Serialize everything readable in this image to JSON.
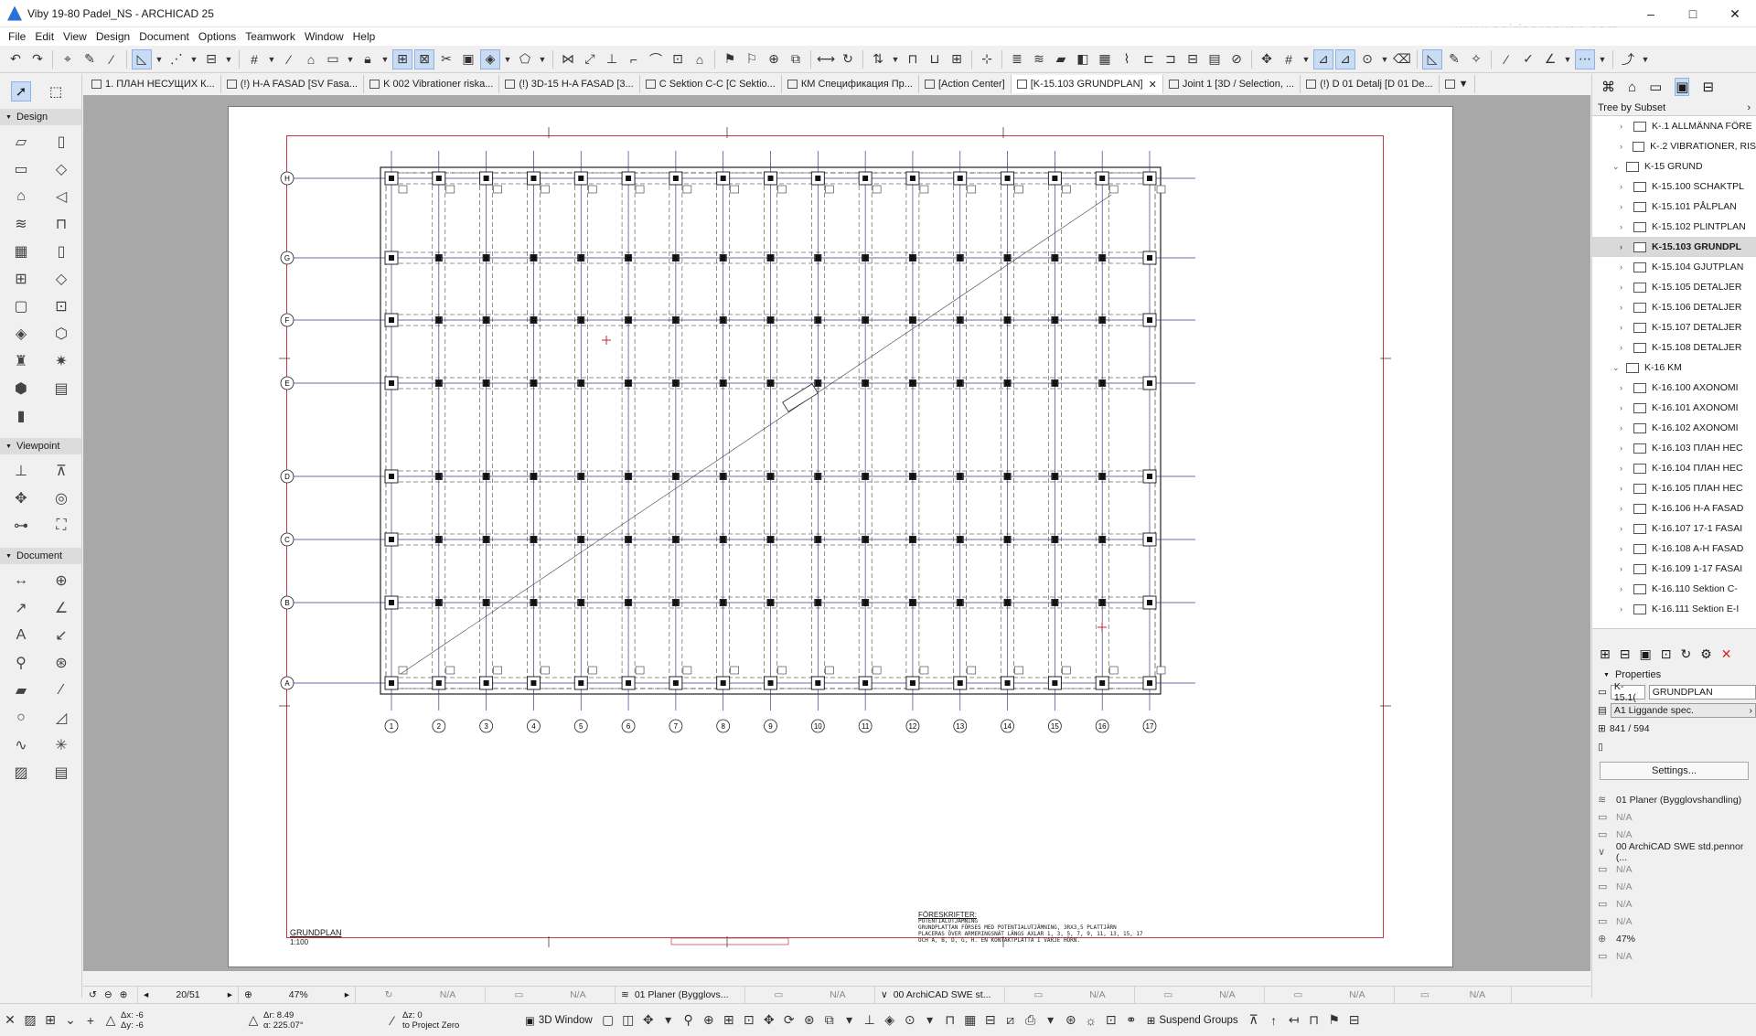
{
  "window": {
    "title": "Viby 19-80 Padel_NS - ARCHICAD 25",
    "watermark": "www.nairisargsyan.com",
    "controls": [
      "–",
      "□",
      "✕"
    ]
  },
  "menu": [
    "File",
    "Edit",
    "View",
    "Design",
    "Document",
    "Options",
    "Teamwork",
    "Window",
    "Help"
  ],
  "tabs": [
    {
      "label": "1. ПЛАН НЕСУЩИХ К...",
      "active": false
    },
    {
      "label": "(!) H-A FASAD  [SV Fasa...",
      "active": false
    },
    {
      "label": "K 002 Vibrationer riska...",
      "active": false
    },
    {
      "label": "(!) 3D-15 H-A FASAD [3...",
      "active": false
    },
    {
      "label": "C Sektion C-C [C Sektio...",
      "active": false
    },
    {
      "label": "КМ Спецификация Пр...",
      "active": false
    },
    {
      "label": "[Action Center]",
      "active": false
    },
    {
      "label": "[K-15.103 GRUNDPLAN]",
      "active": true
    },
    {
      "label": "Joint 1 [3D / Selection, ...",
      "active": false
    },
    {
      "label": "(!) D 01 Detalj [D 01 De...",
      "active": false
    }
  ],
  "toolbox": {
    "design_label": "Design",
    "viewpoint_label": "Viewpoint",
    "document_label": "Document"
  },
  "drawing": {
    "grid_rows": [
      "H",
      "G",
      "F",
      "E",
      "D",
      "C",
      "B",
      "A"
    ],
    "grid_cols": [
      "1",
      "2",
      "3",
      "4",
      "5",
      "6",
      "7",
      "8",
      "9",
      "10",
      "11",
      "12",
      "13",
      "14",
      "15",
      "16",
      "17"
    ],
    "title": "GRUNDPLAN",
    "scale": "1:100",
    "notes_heading": "FÖRESKRIFTER:",
    "notes_lines": [
      "POTENTIALUTJÄMNING",
      "GRUNDPLATTAN FÖRSES MED POTENTIALUTJÄMNING, 3RX3,5 PLATTJÄRN",
      "PLACERAS ÖVER ARMERINGSNÄT LÄNGS AXLAR 1, 3, 5, 7, 9, 11, 13, 15, 17",
      "OCH A, B, D, G, H. EN KONTAKTPLATTA I VARJE HÖRN."
    ]
  },
  "navigator": {
    "subset_label": "Tree by Subset",
    "tree": [
      {
        "label": "K-.1 ALLMÄNNA FÖRE",
        "level": 1,
        "chevron": "›",
        "selected": false
      },
      {
        "label": "K-.2 VIBRATIONER, RIS",
        "level": 1,
        "chevron": "›",
        "selected": false
      },
      {
        "label": "K-15 GRUND",
        "level": 0,
        "chevron": "⌄",
        "selected": false
      },
      {
        "label": "K-15.100 SCHAKTPL",
        "level": 1,
        "chevron": "›",
        "selected": false
      },
      {
        "label": "K-15.101 PÅLPLAN",
        "level": 1,
        "chevron": "›",
        "selected": false
      },
      {
        "label": "K-15.102 PLINTPLAN",
        "level": 1,
        "chevron": "›",
        "selected": false
      },
      {
        "label": "K-15.103 GRUNDPL",
        "level": 1,
        "chevron": "›",
        "selected": true
      },
      {
        "label": "K-15.104 GJUTPLAN",
        "level": 1,
        "chevron": "›",
        "selected": false
      },
      {
        "label": "K-15.105 DETALJER",
        "level": 1,
        "chevron": "›",
        "selected": false
      },
      {
        "label": "K-15.106 DETALJER",
        "level": 1,
        "chevron": "›",
        "selected": false
      },
      {
        "label": "K-15.107 DETALJER",
        "level": 1,
        "chevron": "›",
        "selected": false
      },
      {
        "label": "K-15.108 DETALJER",
        "level": 1,
        "chevron": "›",
        "selected": false
      },
      {
        "label": "K-16 KM",
        "level": 0,
        "chevron": "⌄",
        "selected": false
      },
      {
        "label": "K-16.100 AXONOMI",
        "level": 1,
        "chevron": "›",
        "selected": false
      },
      {
        "label": "K-16.101 AXONOMI",
        "level": 1,
        "chevron": "›",
        "selected": false
      },
      {
        "label": "K-16.102 AXONOMI",
        "level": 1,
        "chevron": "›",
        "selected": false
      },
      {
        "label": "K-16.103 ПЛАН НЕС",
        "level": 1,
        "chevron": "›",
        "selected": false
      },
      {
        "label": "K-16.104 ПЛАН НЕС",
        "level": 1,
        "chevron": "›",
        "selected": false
      },
      {
        "label": "K-16.105 ПЛАН НЕС",
        "level": 1,
        "chevron": "›",
        "selected": false
      },
      {
        "label": "K-16.106 H-A FASAD",
        "level": 1,
        "chevron": "›",
        "selected": false
      },
      {
        "label": "K-16.107 17-1 FASAI",
        "level": 1,
        "chevron": "›",
        "selected": false
      },
      {
        "label": "K-16.108 A-H FASAD",
        "level": 1,
        "chevron": "›",
        "selected": false
      },
      {
        "label": "K-16.109 1-17 FASAI",
        "level": 1,
        "chevron": "›",
        "selected": false
      },
      {
        "label": "K-16.110 Sektion C-",
        "level": 1,
        "chevron": "›",
        "selected": false
      },
      {
        "label": "K-16.111 Sektion E-I",
        "level": 1,
        "chevron": "›",
        "selected": false
      }
    ],
    "properties_label": "Properties",
    "id_value": "K-15.1(",
    "name_value": "GRUNDPLAN",
    "paper_value": "A1 Liggande spec.",
    "size_value": "841 / 594",
    "settings_label": "Settings...",
    "layers": [
      {
        "text": "01 Planer (Bygglovshandling)",
        "dark": true,
        "icon": "≋"
      },
      {
        "text": "N/A",
        "dark": false,
        "icon": "▭"
      },
      {
        "text": "N/A",
        "dark": false,
        "icon": "▭"
      },
      {
        "text": "00 ArchiCAD SWE std.pennor (...",
        "dark": true,
        "icon": "∨"
      },
      {
        "text": "N/A",
        "dark": false,
        "icon": "▭"
      },
      {
        "text": "N/A",
        "dark": false,
        "icon": "▭"
      },
      {
        "text": "N/A",
        "dark": false,
        "icon": "▭"
      },
      {
        "text": "N/A",
        "dark": false,
        "icon": "▭"
      },
      {
        "text": "47%",
        "dark": true,
        "icon": "⊕"
      },
      {
        "text": "N/A",
        "dark": false,
        "icon": "▭"
      }
    ]
  },
  "statusbar": {
    "page": "20/51",
    "zoom": "47%",
    "na1": "N/A",
    "na2": "N/A",
    "layer": "01 Planer (Bygglovs...",
    "na3": "N/A",
    "pen": "00 ArchiCAD SWE st...",
    "na4": "N/A",
    "na5": "N/A",
    "na6": "N/A",
    "na7": "N/A"
  },
  "coords": {
    "dx": "Δx: -6",
    "dy": "Δy: -6",
    "dr": "Δr: 8.49",
    "angle": "α: 225.07°",
    "dz": "Δz: 0",
    "dz_ref": "to Project Zero",
    "view3d": "3D Window",
    "suspend": "Suspend Groups"
  }
}
